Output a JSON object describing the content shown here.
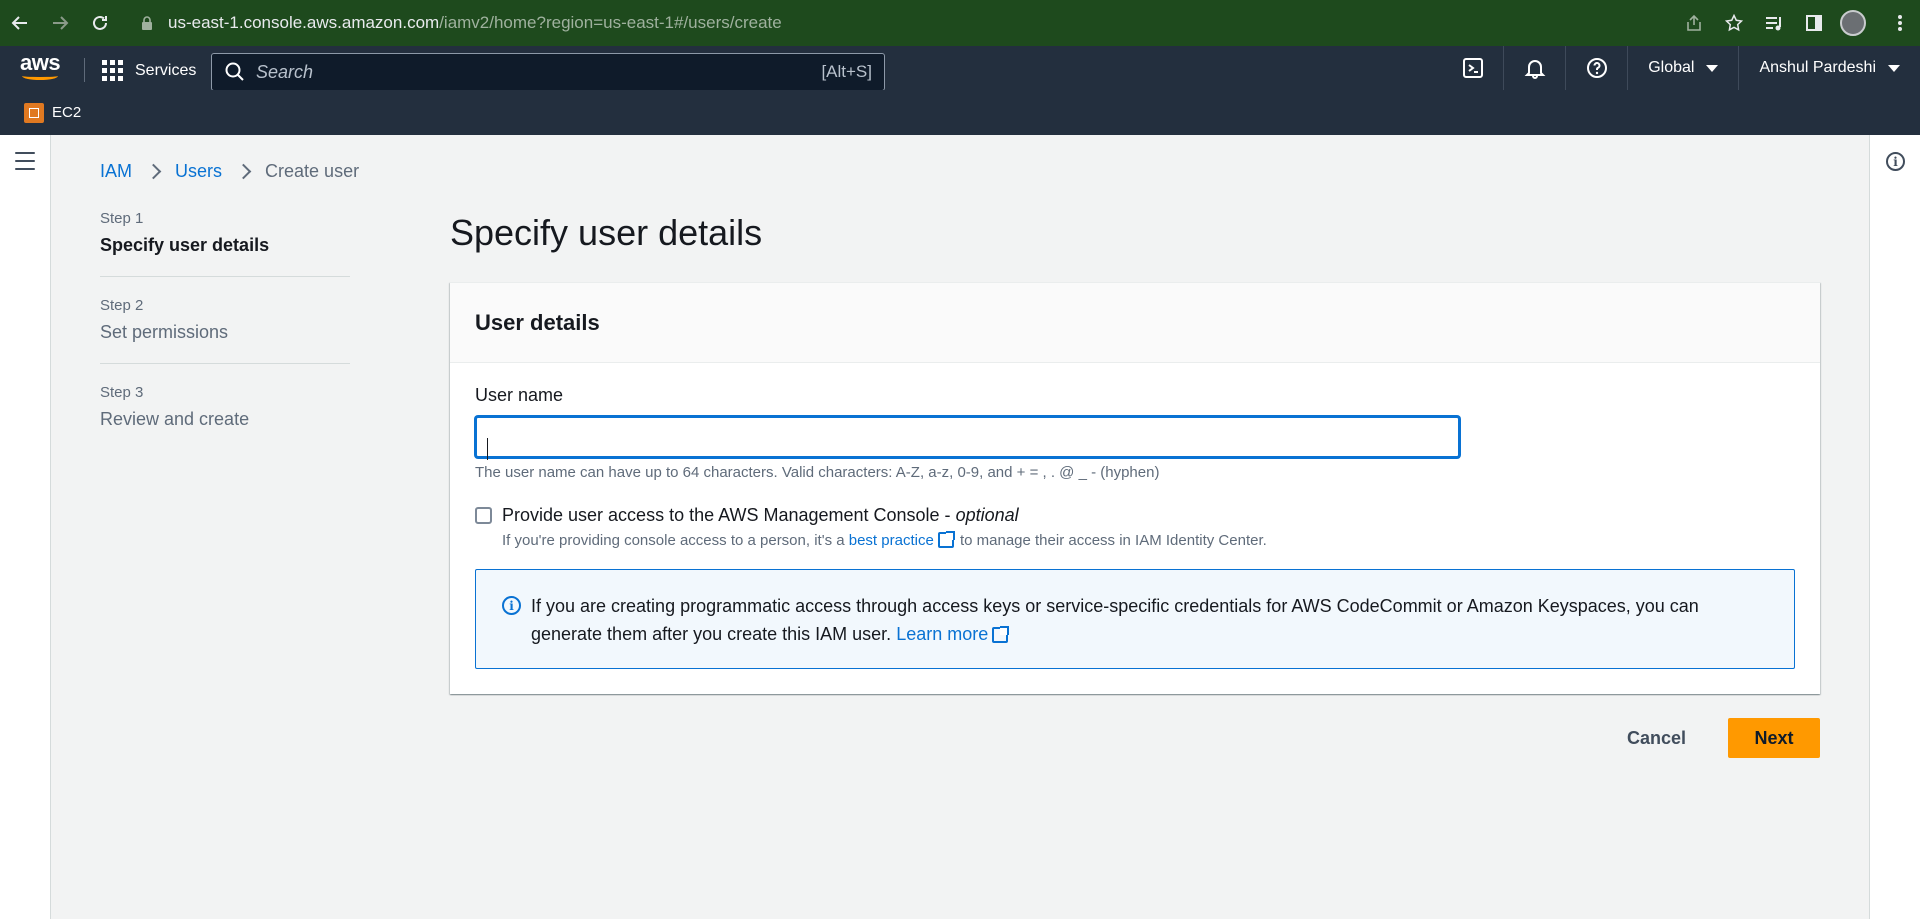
{
  "browser": {
    "url_host": "us-east-1.console.aws.amazon.com",
    "url_path": "/iamv2/home?region=us-east-1#/users/create"
  },
  "aws_nav": {
    "logo": "aws",
    "services_label": "Services",
    "search_placeholder": "Search",
    "search_shortcut": "[Alt+S]",
    "region_label": "Global",
    "account_label": "Anshul Pardeshi"
  },
  "favorites": {
    "ec2_label": "EC2"
  },
  "breadcrumb": {
    "items": [
      "IAM",
      "Users"
    ],
    "current": "Create user"
  },
  "steps": [
    {
      "num": "Step 1",
      "name": "Specify user details"
    },
    {
      "num": "Step 2",
      "name": "Set permissions"
    },
    {
      "num": "Step 3",
      "name": "Review and create"
    }
  ],
  "page": {
    "title": "Specify user details"
  },
  "panel": {
    "header": "User details",
    "username_label": "User name",
    "username_value": "",
    "username_hint": "The user name can have up to 64 characters. Valid characters: A-Z, a-z, 0-9, and + = , . @ _ - (hyphen)",
    "console_label": "Provide user access to the AWS Management Console - ",
    "console_optional": "optional",
    "console_desc_prefix": "If you're providing console access to a person, it's a ",
    "console_desc_link": "best practice",
    "console_desc_suffix": " to manage their access in IAM Identity Center.",
    "alert_text": "If you are creating programmatic access through access keys or service-specific credentials for AWS CodeCommit or Amazon Keyspaces, you can generate them after you create this IAM user. ",
    "alert_link": "Learn more"
  },
  "actions": {
    "cancel_label": "Cancel",
    "next_label": "Next"
  },
  "colors": {
    "nav_bg": "#232f3e",
    "link": "#0972d3",
    "primary_button": "#ff9900",
    "chrome_bg": "#1e4a1d"
  }
}
